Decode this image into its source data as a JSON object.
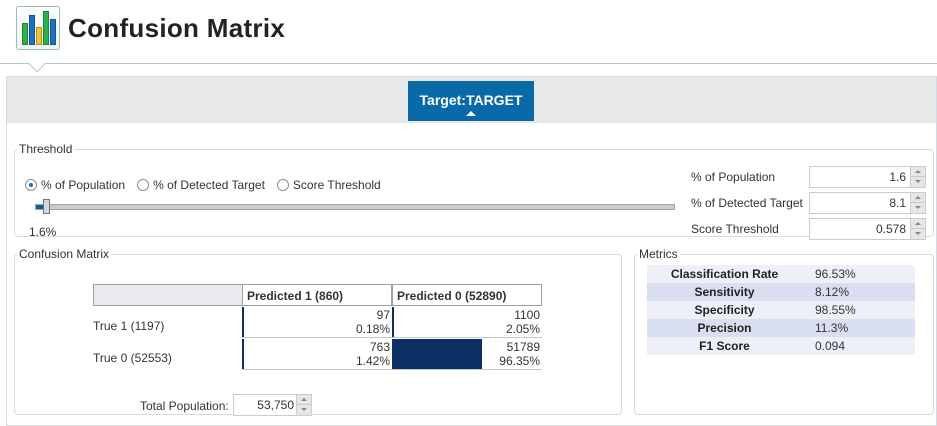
{
  "header": {
    "title": "Confusion Matrix",
    "icon": "bar-chart-icon",
    "icon_colors": [
      "#2bb14a",
      "#1c6fc1",
      "#f1c232",
      "#2bb14a",
      "#1c6fc1"
    ]
  },
  "target_tab": {
    "label": "Target:TARGET",
    "color": "#0a6aa8"
  },
  "threshold": {
    "legend": "Threshold",
    "options": [
      {
        "label": "% of Population",
        "selected": true
      },
      {
        "label": "% of Detected Target",
        "selected": false
      },
      {
        "label": "Score Threshold",
        "selected": false
      }
    ],
    "slider_value_label": "1.6%",
    "slider_fraction": 0.016,
    "fields": [
      {
        "label": "% of Population",
        "value": "1.6"
      },
      {
        "label": "% of Detected Target",
        "value": "8.1"
      },
      {
        "label": "Score Threshold",
        "value": "0.578"
      }
    ]
  },
  "confusion_matrix": {
    "legend": "Confusion Matrix",
    "columns": [
      "Predicted 1  (860)",
      "Predicted 0  (52890)"
    ],
    "rows": [
      {
        "label": "True 1  (1197)",
        "cells": [
          {
            "count": "97",
            "pct": "0.18%",
            "share": 0.0018
          },
          {
            "count": "1100",
            "pct": "2.05%",
            "share": 0.0205
          }
        ]
      },
      {
        "label": "True 0  (52553)",
        "cells": [
          {
            "count": "763",
            "pct": "1.42%",
            "share": 0.0142
          },
          {
            "count": "51789",
            "pct": "96.35%",
            "share": 0.9635
          }
        ]
      }
    ],
    "total_label": "Total Population:",
    "total_value": "53,750",
    "heat_color": "#0b2e63"
  },
  "metrics": {
    "legend": "Metrics",
    "items": [
      {
        "name": "Classification Rate",
        "value": "96.53%"
      },
      {
        "name": "Sensitivity",
        "value": "8.12%"
      },
      {
        "name": "Specificity",
        "value": "98.55%"
      },
      {
        "name": "Precision",
        "value": "11.3%"
      },
      {
        "name": "F1 Score",
        "value": "0.094"
      }
    ]
  }
}
